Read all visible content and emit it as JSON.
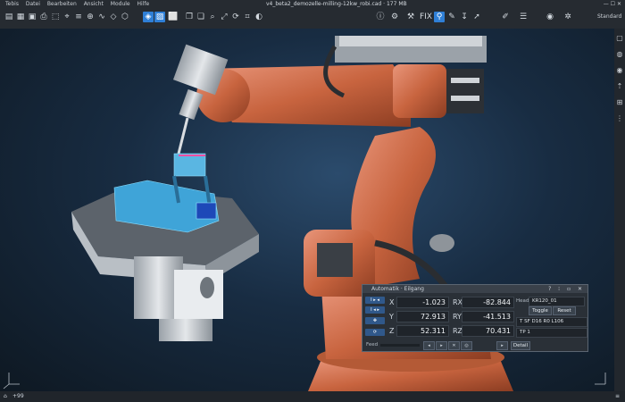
{
  "menu": [
    "Tebis",
    "Datei",
    "Bearbeiten",
    "Ansicht",
    "Module",
    "Hilfe"
  ],
  "window": {
    "title": "v4_beta2_demozelle-milling-12kw_robi.cad · 177 MB"
  },
  "mode": "Standard",
  "panel": {
    "title": "Automatik · Eilgang",
    "rows": [
      {
        "axis": "X",
        "value": "-1.023",
        "raxis": "RX",
        "rvalue": "-82.844"
      },
      {
        "axis": "Y",
        "value": "72.913",
        "raxis": "RY",
        "rvalue": "-41.513"
      },
      {
        "axis": "Z",
        "value": "52.311",
        "raxis": "RZ",
        "rvalue": "70.431"
      }
    ],
    "head_label": "Head",
    "head_value": "KR120_01",
    "toggle_label": "Toggle",
    "reset_label": "Reset",
    "tool_value": "T SF D16 R0 L106",
    "tp_value": "TP 1",
    "feed_label": "Feed",
    "detail_label": "Detail"
  },
  "status": {
    "zoom": "+99"
  }
}
